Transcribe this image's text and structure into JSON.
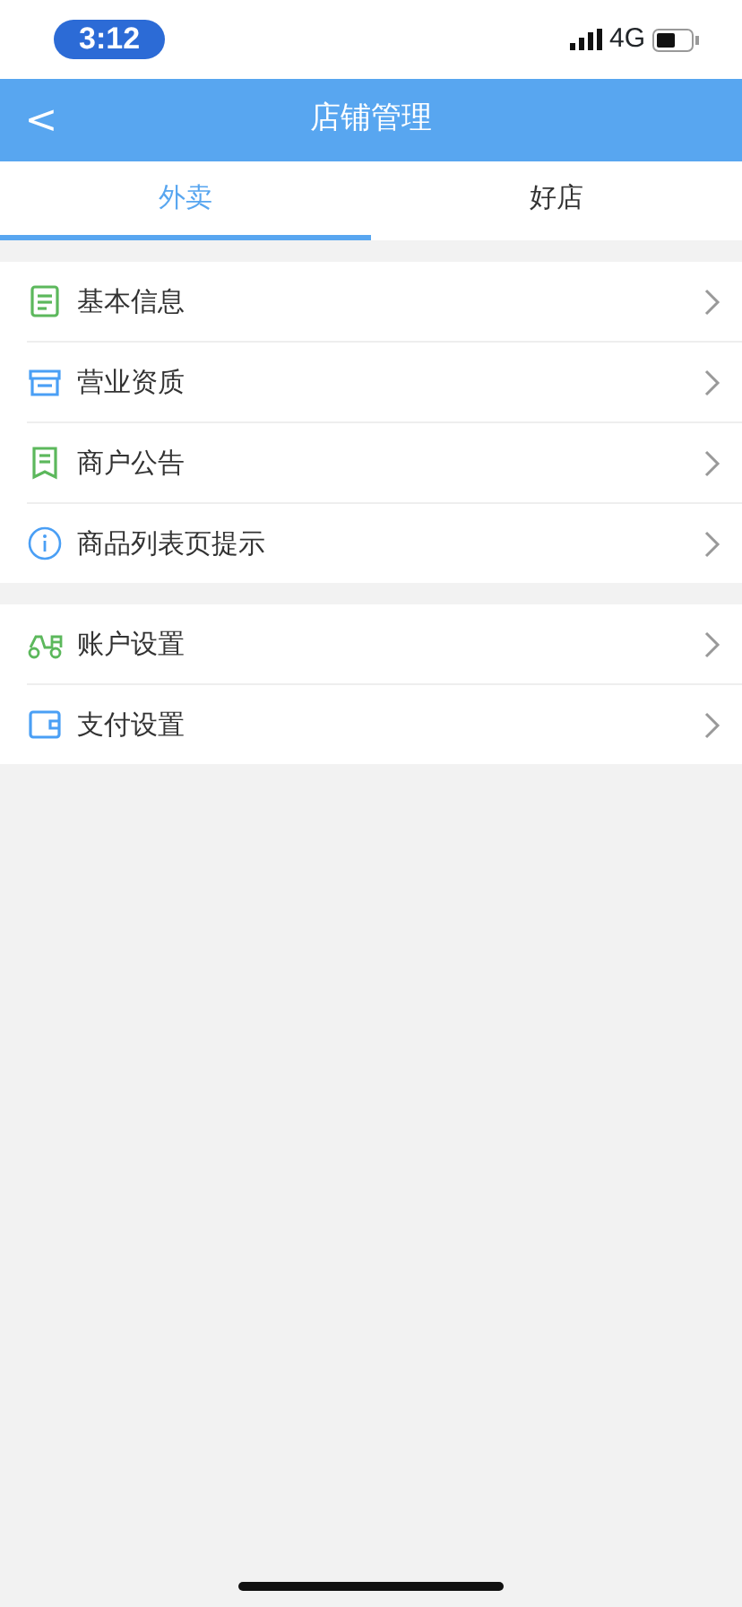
{
  "status_bar": {
    "time": "3:12",
    "network": "4G"
  },
  "nav_bar": {
    "back": "<",
    "title": "店铺管理"
  },
  "tabs": [
    {
      "label": "外卖",
      "selected": true
    },
    {
      "label": "好店",
      "selected": false
    }
  ],
  "groups": [
    {
      "items": [
        {
          "label": "基本信息",
          "kind": "form",
          "color": "#5cb85c"
        },
        {
          "label": "营业资质",
          "kind": "store",
          "color": "#4a9ff5"
        },
        {
          "label": "商户公告",
          "kind": "receipt",
          "color": "#5cb85c"
        },
        {
          "label": "商品列表页提示",
          "kind": "info",
          "color": "#4a9ff5"
        }
      ]
    },
    {
      "items": [
        {
          "label": "账户设置",
          "kind": "truck",
          "color": "#5cb85c"
        },
        {
          "label": "支付设置",
          "kind": "wallet",
          "color": "#4a9ff5"
        }
      ]
    }
  ]
}
